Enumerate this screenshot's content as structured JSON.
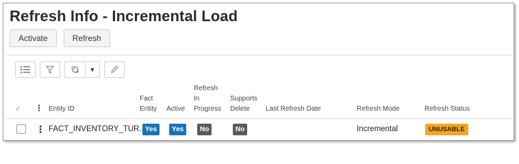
{
  "page": {
    "title": "Refresh Info - Incremental Load"
  },
  "commands": {
    "activate_label": "Activate",
    "refresh_label": "Refresh"
  },
  "toolbar": {
    "icons": [
      "list-icon",
      "filter-icon",
      "group-icon",
      "chevron-down-icon",
      "edit-icon"
    ]
  },
  "table": {
    "columns": {
      "entity_id": "Entity ID",
      "fact_entity": [
        "Fact",
        "Entity"
      ],
      "active": "Active",
      "refresh_in_progress": [
        "Refresh",
        "In",
        "Progress"
      ],
      "supports_delete": [
        "Supports",
        "Delete"
      ],
      "last_refresh_date": "Last Refresh Date",
      "refresh_mode": "Refresh Mode",
      "refresh_status": "Refresh Status"
    },
    "rows": [
      {
        "entity_id": "FACT_INVENTORY_TUR...",
        "fact_entity": "Yes",
        "active": "Yes",
        "refresh_in_progress": "No",
        "supports_delete": "No",
        "last_refresh_date": "",
        "refresh_mode": "Incremental",
        "refresh_status": "UNUSABLE"
      }
    ]
  },
  "colors": {
    "yes_badge": "#1a73b8",
    "no_badge": "#5a5a5a",
    "unusable_badge": "#f5a623"
  }
}
